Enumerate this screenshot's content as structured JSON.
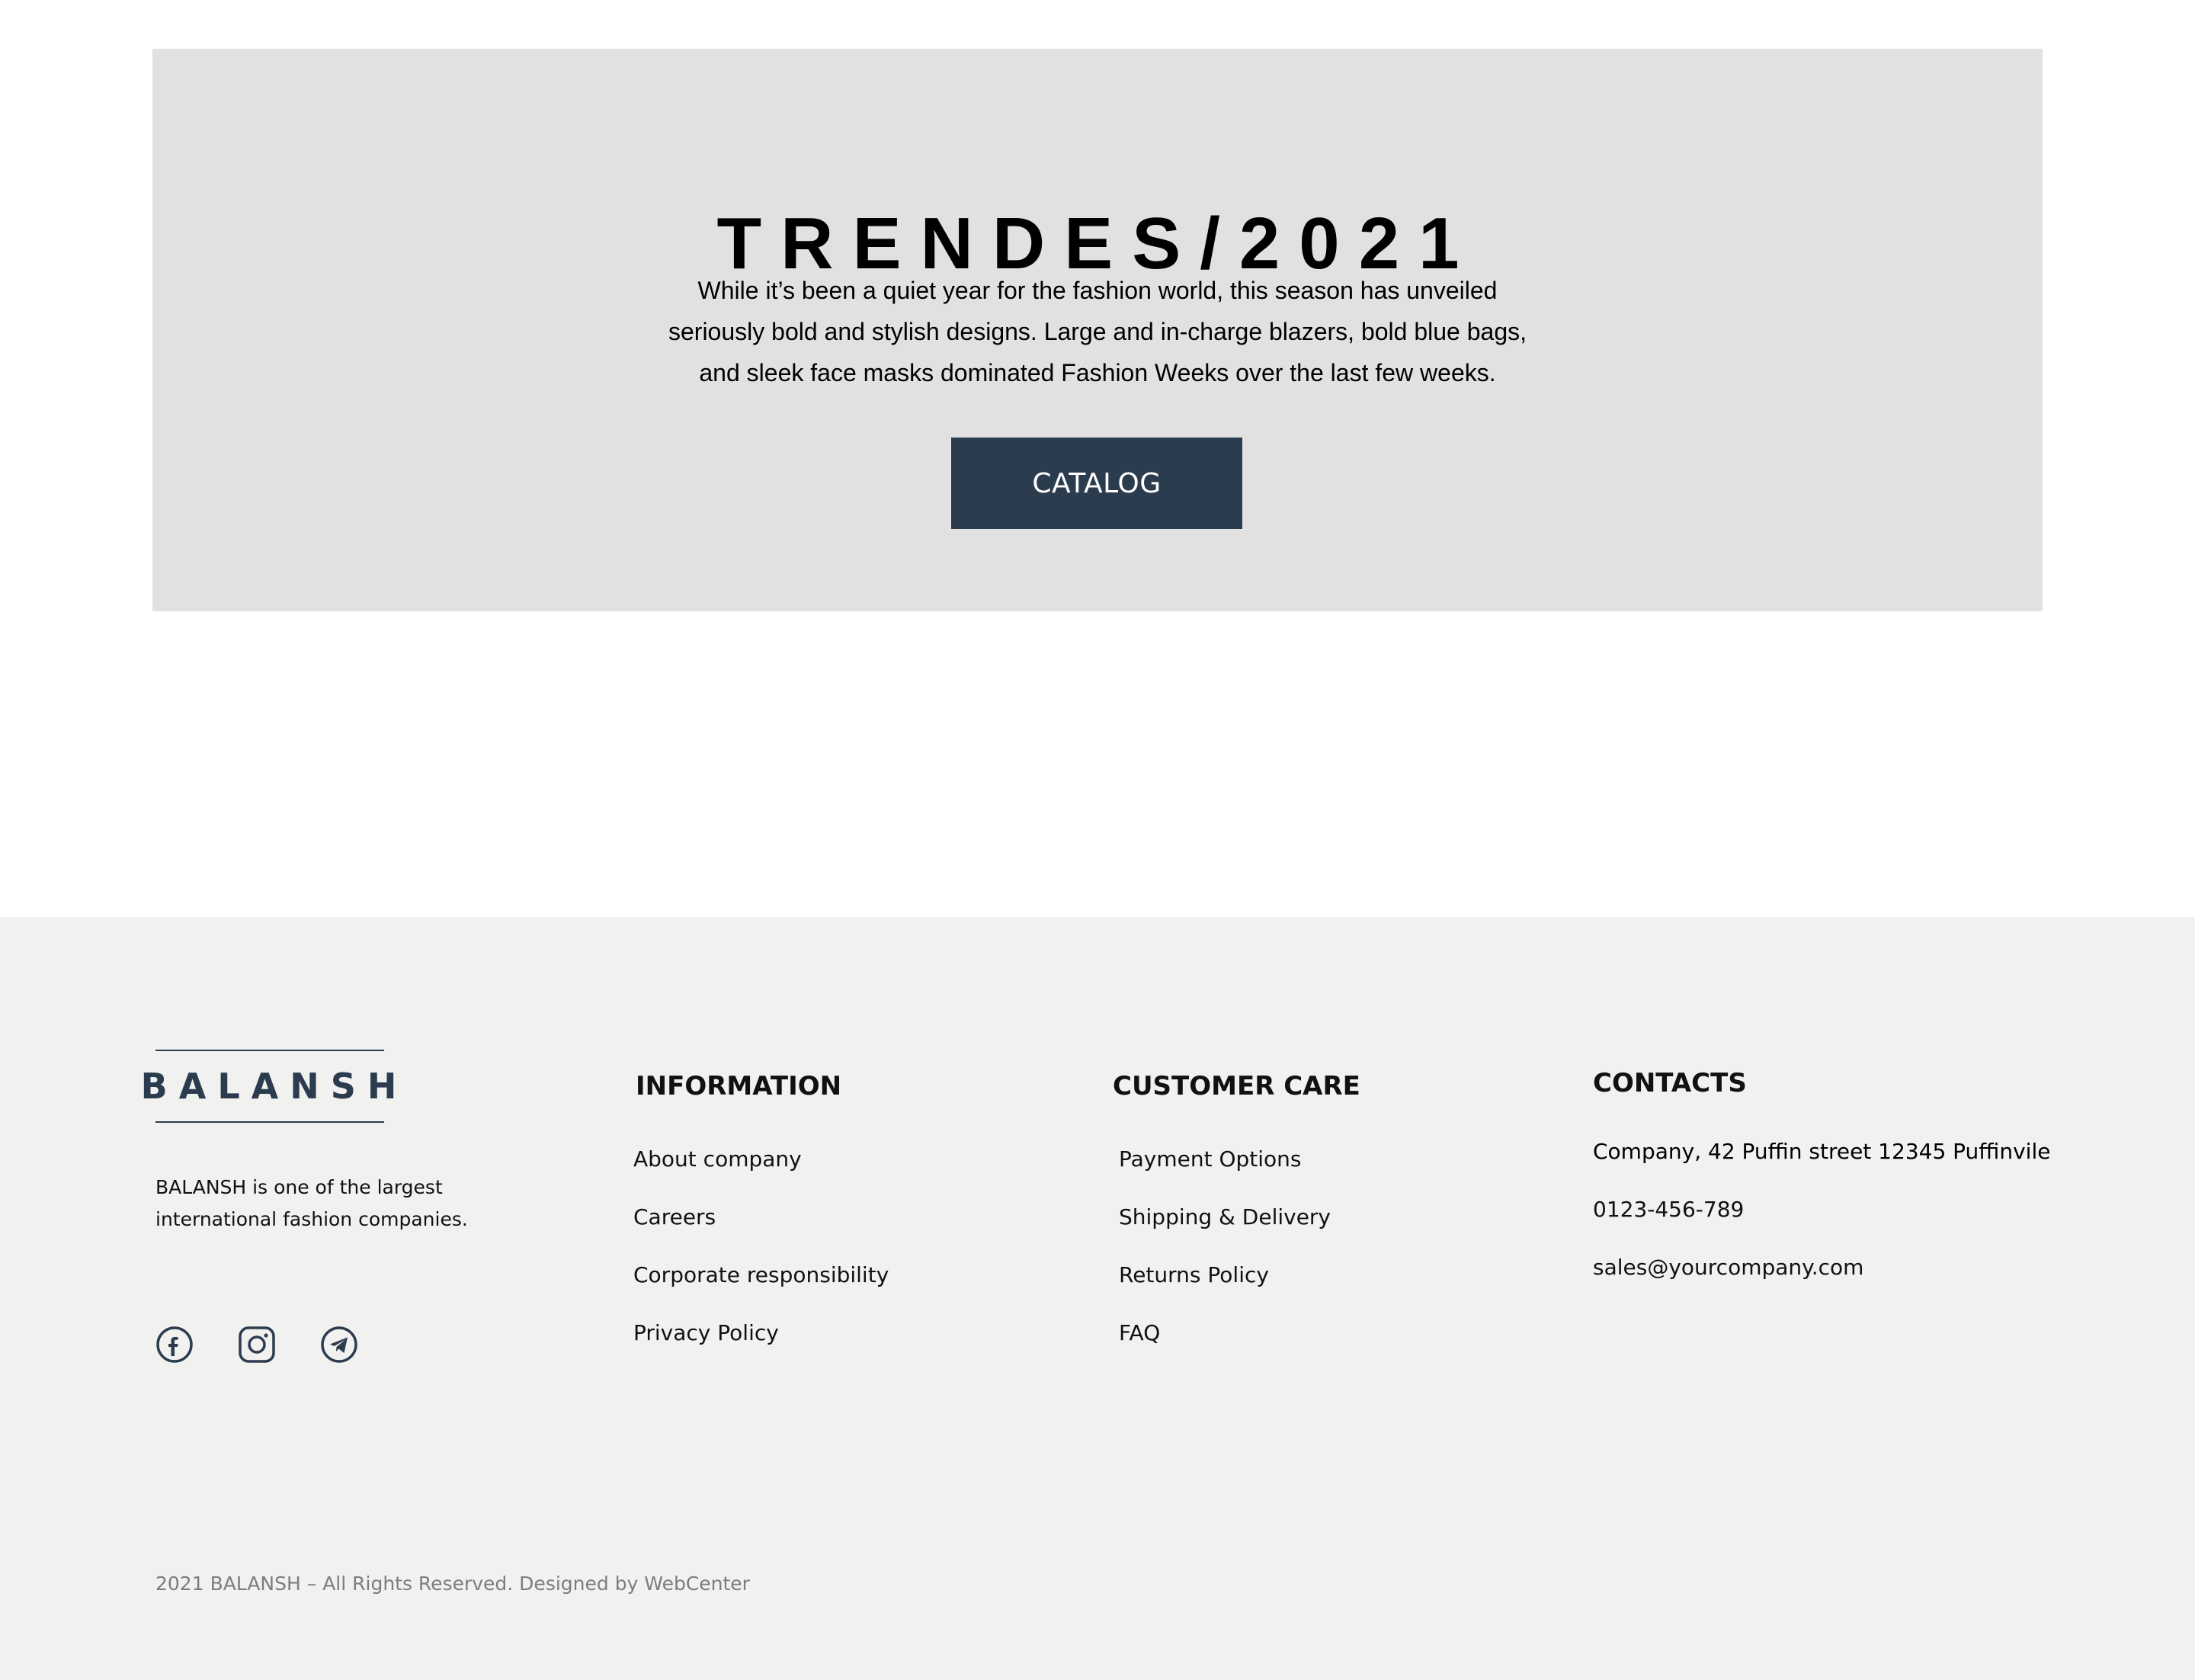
{
  "hero": {
    "title": "TRENDES/2021",
    "text": "While it’s been a quiet year for the fashion world, this season has unveiled seriously bold and stylish designs. Large and in-charge blazers, bold blue bags, and sleek face masks dominated Fashion Weeks over the last few weeks.",
    "button_label": "CATALOG"
  },
  "footer": {
    "logo": "BALANSH",
    "about": "BALANSH is one of the largest international fashion companies.",
    "socials": [
      {
        "icon": "facebook-icon"
      },
      {
        "icon": "instagram-icon"
      },
      {
        "icon": "telegram-icon"
      }
    ],
    "information": {
      "heading": "INFORMATION",
      "links": [
        "About company",
        "Careers",
        "Corporate responsibility",
        "Privacy Policy"
      ]
    },
    "customer_care": {
      "heading": "CUSTOMER CARE",
      "links": [
        "Payment Options",
        "Shipping & Delivery",
        "Returns Policy",
        "FAQ"
      ]
    },
    "contacts": {
      "heading": "CONTACTS",
      "address": "Company, 42 Puffin street 12345 Puffinvile",
      "phone": "0123-456-789",
      "email": "sales@yourcompany.com"
    },
    "copyright": "2021 BALANSH – All Rights Reserved. Designed by WebCenter"
  },
  "colors": {
    "accent": "#2c3c4f",
    "hero_background": "#e0e1e0",
    "footer_background": "#f1f1ef",
    "muted_text": "#7d7d7d"
  }
}
